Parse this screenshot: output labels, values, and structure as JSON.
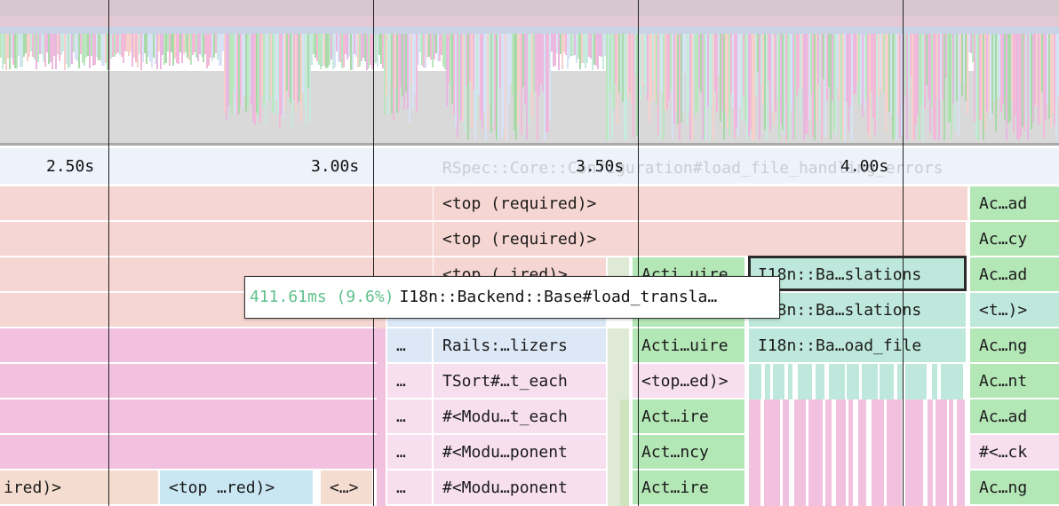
{
  "timeline": {
    "ticks": [
      "2.50s",
      "3.00s",
      "3.50s",
      "4.00s"
    ],
    "ghost_label": "RSpec::Core::Configuration#load_file_handling_errors"
  },
  "colors": {
    "red": "#f6d6d2",
    "pink": "#f3c1e0",
    "pink_light": "#f7dff0",
    "green": "#b4e7b6",
    "teal": "#bfe8dc",
    "blue": "#dde8f7",
    "blue_light": "#c9e6f3",
    "peach": "#f5dcd0",
    "ruler": "#eef3fb"
  },
  "flame": {
    "rows": [
      [
        {
          "label": "",
          "color": "red"
        },
        {
          "label": "<top (required)>",
          "color": "red"
        },
        {
          "label": "Ac…ad",
          "color": "green"
        }
      ],
      [
        {
          "label": "",
          "color": "red"
        },
        {
          "label": "<top (required)>",
          "color": "red"
        },
        {
          "label": "Ac…cy",
          "color": "green"
        }
      ],
      [
        {
          "label": "",
          "color": "red"
        },
        {
          "label": "<top (…ired)>",
          "color": "red"
        },
        {
          "label": "Acti…uire",
          "color": "green"
        },
        {
          "label": "I18n::Ba…slations",
          "color": "teal"
        },
        {
          "label": "Ac…ad",
          "color": "green"
        }
      ],
      [
        {
          "label": "",
          "color": "red"
        },
        {
          "label": "",
          "color": "blue"
        },
        {
          "label": "",
          "color": "green"
        },
        {
          "label": "I18n::Ba…slations",
          "color": "teal"
        },
        {
          "label": "<t…)>",
          "color": "teal"
        }
      ],
      [
        {
          "label": "",
          "color": "pink"
        },
        {
          "label": "…",
          "color": "blue"
        },
        {
          "label": "Rails:…lizers",
          "color": "blue"
        },
        {
          "label": "Acti…uire",
          "color": "green"
        },
        {
          "label": "I18n::Ba…oad_file",
          "color": "teal"
        },
        {
          "label": "Ac…ng",
          "color": "green"
        }
      ],
      [
        {
          "label": "",
          "color": "pink"
        },
        {
          "label": "…",
          "color": "pink_light"
        },
        {
          "label": "TSort#…t_each",
          "color": "pink_light"
        },
        {
          "label": "<top…ed)>",
          "color": "pink_light"
        },
        {
          "label": "Ac…nt",
          "color": "green"
        }
      ],
      [
        {
          "label": "",
          "color": "pink"
        },
        {
          "label": "…",
          "color": "pink_light"
        },
        {
          "label": "#<Modu…t_each",
          "color": "pink_light"
        },
        {
          "label": "Act…ire",
          "color": "green"
        },
        {
          "label": "Ac…ad",
          "color": "green"
        }
      ],
      [
        {
          "label": "",
          "color": "pink"
        },
        {
          "label": "…",
          "color": "pink_light"
        },
        {
          "label": "#<Modu…ponent",
          "color": "pink_light"
        },
        {
          "label": "Act…ncy",
          "color": "green"
        },
        {
          "label": "#<…ck",
          "color": "pink_light"
        }
      ],
      [
        {
          "label": "ired)>",
          "color": "peach"
        },
        {
          "label": "<top …red)>",
          "color": "blue_light"
        },
        {
          "label": "<…>",
          "color": "peach"
        },
        {
          "label": "…",
          "color": "pink_light"
        },
        {
          "label": "#<Modu…ponent",
          "color": "pink_light"
        },
        {
          "label": "Act…ire",
          "color": "green"
        },
        {
          "label": "Ac…ng",
          "color": "green"
        }
      ]
    ]
  },
  "tooltip": {
    "duration": "411.61ms (9.6%)",
    "name": "I18n::Backend::Base#load_transla…"
  }
}
